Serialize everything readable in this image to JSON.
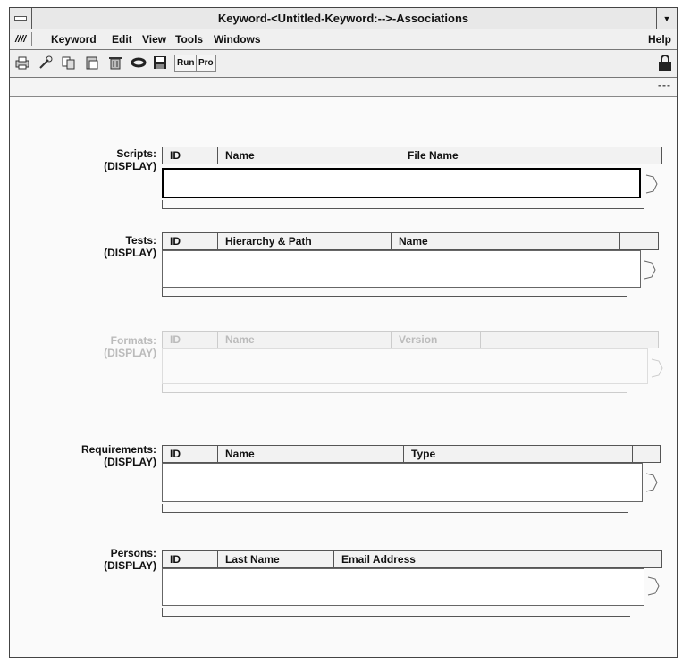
{
  "window": {
    "title": "Keyword-<Untitled-Keyword:-->-Associations",
    "app_icon_label": "////"
  },
  "menubar": {
    "items": [
      "Keyword",
      "Edit",
      "View",
      "Tools",
      "Windows"
    ],
    "help": "Help"
  },
  "toolbar": {
    "icons": [
      "print-icon",
      "tools-icon",
      "copy-icon",
      "paste-icon",
      "delete-icon",
      "refresh-icon",
      "save-icon"
    ],
    "run_label": "Run",
    "pro_label": "Pro",
    "lock_icon": "lock-icon"
  },
  "statusbar": {
    "indicator": "---"
  },
  "sections": [
    {
      "label": "Scripts:",
      "mode": "(DISPLAY)",
      "columns": [
        "ID",
        "Name",
        "File Name"
      ],
      "enabled": true,
      "focused": true
    },
    {
      "label": "Tests:",
      "mode": "(DISPLAY)",
      "columns": [
        "ID",
        "Hierarchy & Path",
        "Name",
        ""
      ],
      "enabled": true,
      "focused": false
    },
    {
      "label": "Formats:",
      "mode": "(DISPLAY)",
      "columns": [
        "ID",
        "Name",
        "Version",
        ""
      ],
      "enabled": false,
      "focused": false
    },
    {
      "label": "Requirements:",
      "mode": "(DISPLAY)",
      "columns": [
        "ID",
        "Name",
        "Type",
        ""
      ],
      "enabled": true,
      "focused": false
    },
    {
      "label": "Persons:",
      "mode": "(DISPLAY)",
      "columns": [
        "ID",
        "Last Name",
        "Email Address"
      ],
      "enabled": true,
      "focused": false
    }
  ]
}
